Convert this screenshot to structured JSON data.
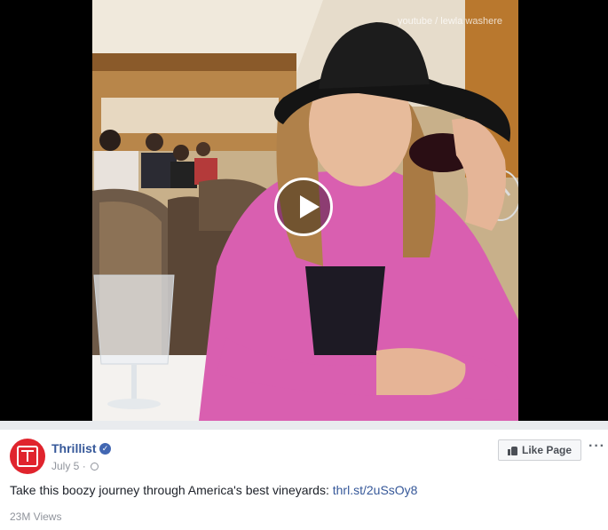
{
  "video": {
    "watermark": "youtube / lewla washere",
    "play_icon": "play-icon"
  },
  "post": {
    "page_name": "Thrillist",
    "verified_icon": "verified-check-icon",
    "date": "July 5",
    "separator": "·",
    "privacy_icon": "globe-icon",
    "like_page_label": "Like Page",
    "more_icon": "ellipsis-icon",
    "more_label": "···",
    "caption_text": "Take this boozy journey through America's best vineyards: ",
    "caption_link": "thrl.st/2uSsOy8",
    "views": "23M Views"
  },
  "colors": {
    "brand_red": "#e0242d",
    "link_blue": "#365899",
    "verified_blue": "#4267b2"
  }
}
